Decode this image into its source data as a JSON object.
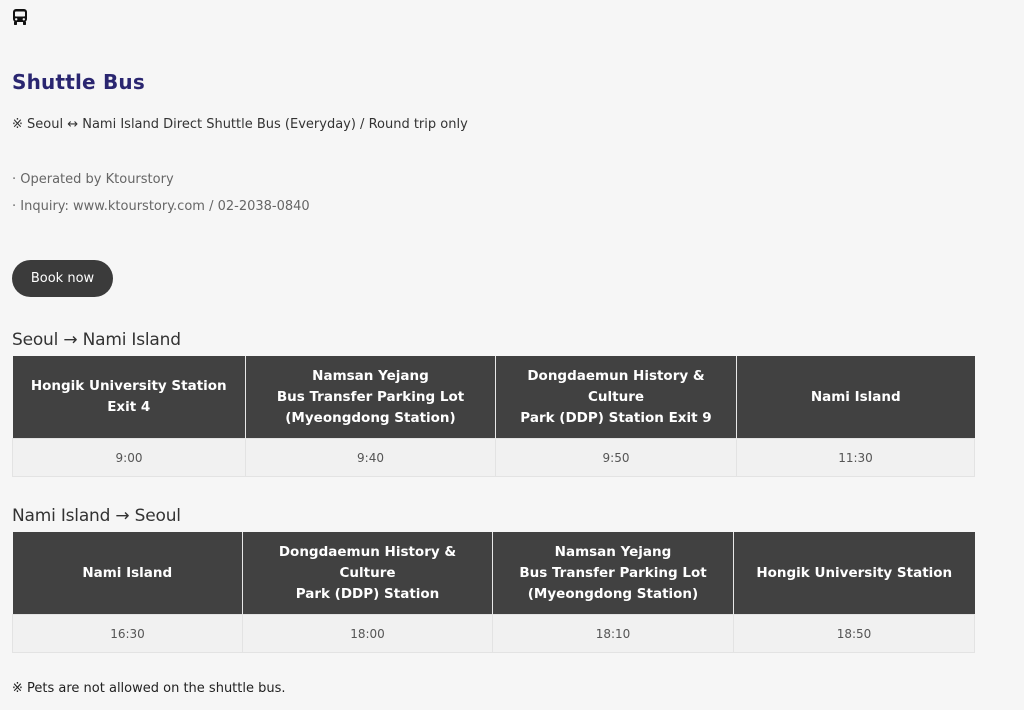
{
  "icons": {
    "bus": "bus-icon"
  },
  "header": {
    "title": "Shuttle Bus",
    "subtitle": "※ Seoul ↔ Nami Island Direct Shuttle Bus (Everyday) / Round trip only",
    "operated_by": "· Operated by Ktourstory",
    "inquiry": "· Inquiry: www.ktourstory.com / 02-2038-0840"
  },
  "book_button": {
    "label": "Book now"
  },
  "outbound": {
    "title": "Seoul → Nami Island",
    "columns": [
      [
        "Hongik University Station",
        "Exit 4"
      ],
      [
        "Namsan Yejang",
        "Bus Transfer Parking Lot",
        "(Myeongdong Station)"
      ],
      [
        "Dongdaemun History & Culture",
        "Park (DDP) Station Exit 9"
      ],
      [
        "Nami Island"
      ]
    ],
    "times": [
      "9:00",
      "9:40",
      "9:50",
      "11:30"
    ]
  },
  "inbound": {
    "title": "Nami Island → Seoul",
    "columns": [
      [
        "Nami Island"
      ],
      [
        "Dongdaemun History & Culture",
        "Park (DDP) Station"
      ],
      [
        "Namsan Yejang",
        "Bus Transfer Parking Lot",
        "(Myeongdong Station)"
      ],
      [
        "Hongik University Station"
      ]
    ],
    "times": [
      "16:30",
      "18:00",
      "18:10",
      "18:50"
    ]
  },
  "notice": "※ Pets are not allowed on the shuttle bus.",
  "colors": {
    "title": "#2a2670",
    "header_cell": "#414141",
    "button": "#3b3b3b",
    "background": "#f6f6f6"
  }
}
